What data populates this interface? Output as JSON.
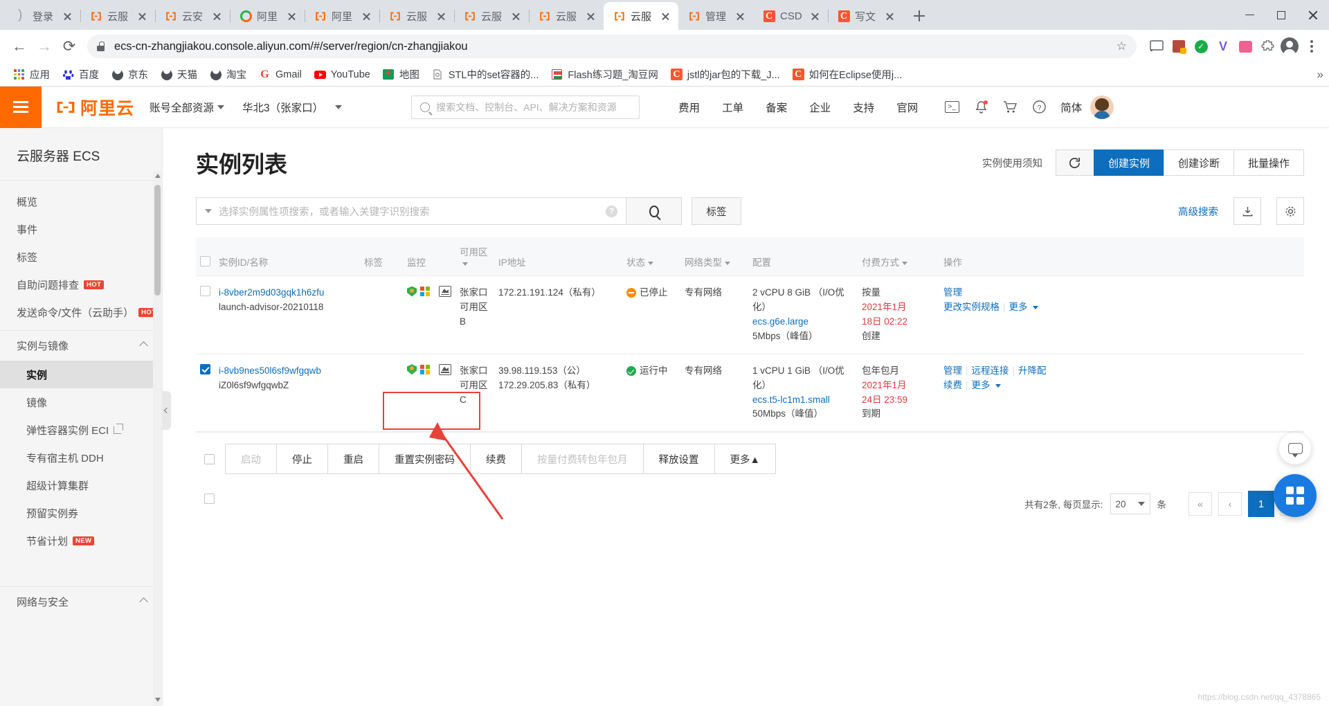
{
  "browser": {
    "tabs": [
      {
        "title": "登录",
        "favicon": "moon-icon",
        "active": false
      },
      {
        "title": "云服",
        "favicon": "aliyun-icon",
        "active": false
      },
      {
        "title": "云安",
        "favicon": "aliyun-icon",
        "active": false
      },
      {
        "title": "阿里",
        "favicon": "opera-o-icon",
        "active": false
      },
      {
        "title": "阿里",
        "favicon": "aliyun-icon",
        "active": false
      },
      {
        "title": "云服",
        "favicon": "aliyun-icon",
        "active": false
      },
      {
        "title": "云服",
        "favicon": "aliyun-icon",
        "active": false
      },
      {
        "title": "云服",
        "favicon": "aliyun-icon",
        "active": false
      },
      {
        "title": "云服",
        "favicon": "aliyun-icon",
        "active": true
      },
      {
        "title": "管理",
        "favicon": "aliyun-icon",
        "active": false
      },
      {
        "title": "CSD",
        "favicon": "csdn-icon",
        "active": false
      },
      {
        "title": "写文",
        "favicon": "csdn-icon",
        "active": false
      }
    ],
    "new_tab_label": "+",
    "window_controls": {
      "minimize": "—",
      "maximize": "▢",
      "close": "✕"
    },
    "nav": {
      "back": "←",
      "forward": "→",
      "reload": "⟳"
    },
    "omnibox": {
      "url": "ecs-cn-zhangjiakou.console.aliyun.com/#/server/region/cn-zhangjiakou",
      "lock_icon": "lock-icon",
      "star_icon": "star-icon"
    },
    "bookmarks": [
      {
        "label": "应用",
        "icon": "apps-grid-icon"
      },
      {
        "label": "百度",
        "icon": "baidu-icon"
      },
      {
        "label": "京东",
        "icon": "jd-icon"
      },
      {
        "label": "天猫",
        "icon": "tmall-icon"
      },
      {
        "label": "淘宝",
        "icon": "taobao-icon"
      },
      {
        "label": "Gmail",
        "icon": "gmail-icon"
      },
      {
        "label": "YouTube",
        "icon": "youtube-icon"
      },
      {
        "label": "地图",
        "icon": "maps-icon"
      },
      {
        "label": "STL中的set容器的...",
        "icon": "page-icon"
      },
      {
        "label": "Flash练习题_淘豆网",
        "icon": "doc-icon"
      },
      {
        "label": "jstl的jar包的下载_J...",
        "icon": "csdn-icon"
      },
      {
        "label": "如何在Eclipse使用j...",
        "icon": "csdn-icon"
      }
    ],
    "bookmarks_overflow": "»"
  },
  "aliyun_header": {
    "menu_icon": "hamburger-icon",
    "logo_text": "阿里云",
    "resource_selector": "账号全部资源",
    "region_selector": "华北3（张家口）",
    "search_placeholder": "搜索文档、控制台、API、解决方案和资源",
    "nav_links": [
      "费用",
      "工单",
      "备案",
      "企业",
      "支持",
      "官网"
    ],
    "icons": [
      "terminal-icon",
      "bell-icon",
      "cart-icon",
      "help-icon"
    ],
    "language": "简体",
    "avatar": "user-avatar"
  },
  "sidebar": {
    "title": "云服务器 ECS",
    "items": [
      {
        "label": "概览",
        "badge": null,
        "type": "item"
      },
      {
        "label": "事件",
        "badge": null,
        "type": "item"
      },
      {
        "label": "标签",
        "badge": null,
        "type": "item"
      },
      {
        "label": "自助问题排查",
        "badge": "HOT",
        "type": "item"
      },
      {
        "label": "发送命令/文件（云助手）",
        "badge": "HOT",
        "type": "item"
      }
    ],
    "group1": {
      "label": "实例与镜像",
      "expanded": true
    },
    "group1_items": [
      {
        "label": "实例",
        "active": true,
        "ext": false,
        "badge": null
      },
      {
        "label": "镜像",
        "active": false,
        "ext": false,
        "badge": null
      },
      {
        "label": "弹性容器实例 ECI",
        "active": false,
        "ext": true,
        "badge": null
      },
      {
        "label": "专有宿主机 DDH",
        "active": false,
        "ext": false,
        "badge": null
      },
      {
        "label": "超级计算集群",
        "active": false,
        "ext": false,
        "badge": null
      },
      {
        "label": "预留实例券",
        "active": false,
        "ext": false,
        "badge": null
      },
      {
        "label": "节省计划",
        "active": false,
        "ext": false,
        "badge": "NEW"
      }
    ],
    "group2": {
      "label": "网络与安全",
      "expanded": false
    }
  },
  "main": {
    "page_title": "实例列表",
    "header_actions": {
      "notice_link": "实例使用须知",
      "refresh_icon": "refresh-icon",
      "create_instance": "创建实例",
      "create_diagnosis": "创建诊断",
      "batch_ops": "批量操作"
    },
    "search": {
      "placeholder": "选择实例属性项搜索，或者输入关键字识别搜索",
      "help_icon": "question-icon",
      "search_icon": "search-icon",
      "tag_button": "标签",
      "advanced_link": "高级搜索",
      "download_icon": "download-icon",
      "settings_icon": "gear-icon"
    },
    "table": {
      "columns": [
        {
          "label": "实例ID/名称",
          "sortable": false
        },
        {
          "label": "标签",
          "sortable": false
        },
        {
          "label": "监控",
          "sortable": false
        },
        {
          "label": "可用区",
          "sortable": true
        },
        {
          "label": "IP地址",
          "sortable": false
        },
        {
          "label": "状态",
          "sortable": true
        },
        {
          "label": "网络类型",
          "sortable": true
        },
        {
          "label": "配置",
          "sortable": false
        },
        {
          "label": "付费方式",
          "sortable": true
        },
        {
          "label": "操作",
          "sortable": false
        }
      ],
      "rows": [
        {
          "selected": false,
          "instance_id": "i-8vber2m9d03gqk1h6zfu",
          "instance_name": "launch-advisor-20210118",
          "zone": "张家口 可用区B",
          "ip_public": "",
          "ip_private": "172.21.191.124（私有）",
          "status": "已停止",
          "status_type": "stopped",
          "network_type": "专有网络",
          "config_spec": "2 vCPU 8 GiB （I/O优化）",
          "config_type": "ecs.g6e.large",
          "config_bandwidth": "5Mbps（峰值）",
          "pay_type": "按量",
          "pay_date1": "2021年1月",
          "pay_date2": "18日 02:22",
          "pay_note": "创建",
          "ops": [
            "管理",
            "更改实例规格",
            "更多"
          ]
        },
        {
          "selected": true,
          "instance_id": "i-8vb9nes50l6sf9wfgqwb",
          "instance_name": "iZ0l6sf9wfgqwbZ",
          "zone": "张家口 可用区C",
          "ip_public": "39.98.119.153（公）",
          "ip_private": "172.29.205.83（私有）",
          "status": "运行中",
          "status_type": "running",
          "network_type": "专有网络",
          "config_spec": "1 vCPU 1 GiB （I/O优化）",
          "config_type": "ecs.t5-lc1m1.small",
          "config_bandwidth": "50Mbps（峰值）",
          "pay_type": "包年包月",
          "pay_date1": "2021年1月",
          "pay_date2": "24日 23:59",
          "pay_note": "到期",
          "ops": [
            "管理",
            "远程连接",
            "升降配",
            "续费",
            "更多"
          ]
        }
      ]
    },
    "toolbar": {
      "select_all": false,
      "buttons": [
        {
          "label": "启动",
          "disabled": true,
          "highlighted": false
        },
        {
          "label": "停止",
          "disabled": false,
          "highlighted": false
        },
        {
          "label": "重启",
          "disabled": false,
          "highlighted": false
        },
        {
          "label": "重置实例密码",
          "disabled": false,
          "highlighted": true
        },
        {
          "label": "续费",
          "disabled": false,
          "highlighted": false
        },
        {
          "label": "按量付费转包年包月",
          "disabled": true,
          "highlighted": false
        },
        {
          "label": "释放设置",
          "disabled": false,
          "highlighted": false
        },
        {
          "label": "更多▲",
          "disabled": false,
          "highlighted": false
        }
      ]
    },
    "pagination": {
      "summary": "共有2条, 每页显示:",
      "page_size": "20",
      "unit": "条",
      "first": "«",
      "prev": "‹",
      "current": "1",
      "next": "›"
    },
    "fabs": {
      "chat": "chat-icon",
      "apps": "apps-icon"
    }
  },
  "annotation": {
    "highlight_color": "#e8413a",
    "arrow": "red-arrow-pointing-to-reset-password-button"
  },
  "watermark": "https://blog.csdn.net/qq_4378865"
}
